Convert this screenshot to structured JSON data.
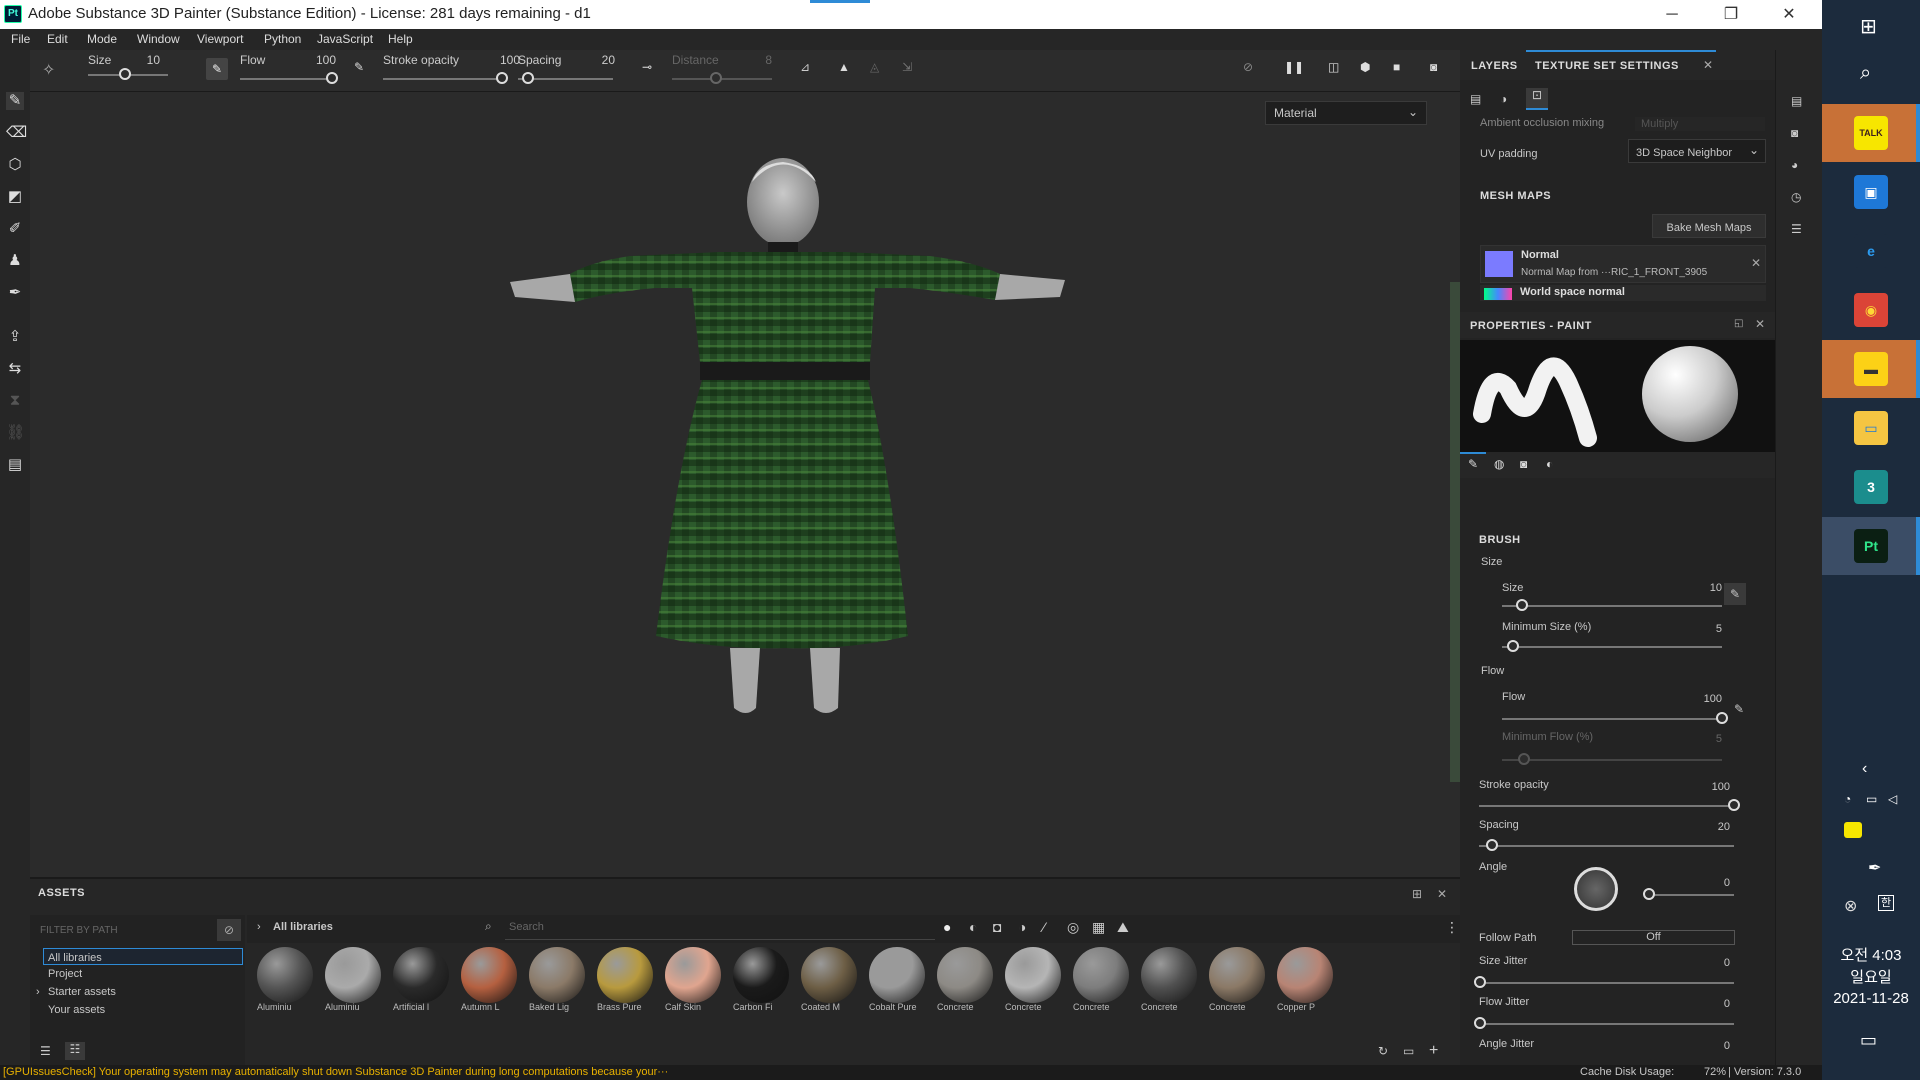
{
  "window": {
    "title": "Adobe Substance 3D Painter (Substance Edition) - License: 281 days remaining - d1",
    "logo": "Pt",
    "minimize_glyph": "─",
    "maximize_glyph": "❐",
    "close_glyph": "✕"
  },
  "menu": [
    "File",
    "Edit",
    "Mode",
    "Window",
    "Viewport",
    "Python",
    "JavaScript",
    "Help"
  ],
  "toolbar": {
    "size_label": "Size",
    "size_value": "10",
    "flow_label": "Flow",
    "flow_value": "100",
    "stroke_label": "Stroke opacity",
    "stroke_value": "100",
    "spacing_label": "Spacing",
    "spacing_value": "20",
    "distance_label": "Distance",
    "distance_value": "8"
  },
  "viewport": {
    "mode_select": "Material"
  },
  "assets": {
    "title": "ASSETS",
    "filter_placeholder": "FILTER BY PATH",
    "tree": [
      "All libraries",
      "Project",
      "Starter assets",
      "Your assets"
    ],
    "breadcrumb": "All libraries",
    "search_placeholder": "Search",
    "materials": [
      {
        "label": "Aluminiu",
        "color": "#555"
      },
      {
        "label": "Aluminiu",
        "color": "#aaa"
      },
      {
        "label": "Artificial l",
        "color": "#2a2a2a"
      },
      {
        "label": "Autumn L",
        "color": "#b56040"
      },
      {
        "label": "Baked Lig",
        "color": "#8b7a68"
      },
      {
        "label": "Brass Pure",
        "color": "#b89a3e"
      },
      {
        "label": "Calf Skin",
        "color": "#e0a58f"
      },
      {
        "label": "Carbon Fi",
        "color": "#1a1a1a"
      },
      {
        "label": "Coated M",
        "color": "#6d5e45"
      },
      {
        "label": "Cobalt Pure",
        "color": "#9a9a9a"
      },
      {
        "label": "Concrete",
        "color": "#8d8a85"
      },
      {
        "label": "Concrete",
        "color": "#b5b5b5"
      },
      {
        "label": "Concrete",
        "color": "#7d7d7d"
      },
      {
        "label": "Concrete",
        "color": "#505050"
      },
      {
        "label": "Concrete",
        "color": "#8b7966"
      },
      {
        "label": "Copper P",
        "color": "#b88474"
      }
    ]
  },
  "texture_set": {
    "tab_layers": "LAYERS",
    "tab_tss": "TEXTURE SET SETTINGS",
    "ao_label": "Ambient occlusion mixing",
    "ao_value": "Multiply",
    "uv_label": "UV padding",
    "uv_value": "3D Space Neighbor",
    "mesh_maps": "MESH MAPS",
    "bake_button": "Bake Mesh Maps",
    "normal_title": "Normal",
    "normal_desc": "Normal Map from ···RIC_1_FRONT_3905",
    "world_normal": "World space normal"
  },
  "properties": {
    "title": "PROPERTIES - PAINT",
    "brush": "BRUSH",
    "size_group": "Size",
    "size_label": "Size",
    "size_value": "10",
    "size_level": 0.09,
    "minsize_label": "Minimum Size (%)",
    "minsize_value": "5",
    "minsize_level": 0.05,
    "flow_group": "Flow",
    "flow_label": "Flow",
    "flow_value": "100",
    "flow_level": 1.0,
    "minflow_label": "Minimum Flow (%)",
    "minflow_value": "5",
    "stroke_label": "Stroke opacity",
    "stroke_value": "100",
    "stroke_level": 1.0,
    "spacing_label": "Spacing",
    "spacing_value": "20",
    "spacing_level": 0.05,
    "angle_label": "Angle",
    "angle_value": "0",
    "follow_label": "Follow Path",
    "follow_value": "Off",
    "sizej_label": "Size Jitter",
    "sizej_value": "0",
    "flowj_label": "Flow Jitter",
    "flowj_value": "0",
    "anglej_label": "Angle Jitter",
    "anglej_value": "0"
  },
  "status": {
    "warning": "[GPUIssuesCheck] Your operating system may automatically shut down Substance 3D Painter during long computations because your···",
    "cache_label": "Cache Disk Usage:",
    "cache_value": "72%",
    "version": "| Version: 7.3.0"
  },
  "taskbar": {
    "time": "오전 4:03",
    "day": "일요일",
    "date": "2021-11-28",
    "ime": "한",
    "apps": [
      {
        "name": "kakaotalk",
        "glyph": "TALK",
        "bg": "#f7e600",
        "fg": "#3c1e1e",
        "tile": "#c87137"
      },
      {
        "name": "remote-desktop",
        "glyph": "▣",
        "bg": "#1e78d7",
        "fg": "#fff",
        "tile": ""
      },
      {
        "name": "internet-explorer",
        "glyph": "e",
        "bg": "#1c2b3d",
        "fg": "#2b9bf0",
        "tile": ""
      },
      {
        "name": "chrome",
        "glyph": "◉",
        "bg": "#db4437",
        "fg": "#fdd835",
        "tile": ""
      },
      {
        "name": "sticky-notes",
        "glyph": "▬",
        "bg": "#fcd116",
        "fg": "#333",
        "tile": "#c87137"
      },
      {
        "name": "file-explorer",
        "glyph": "▭",
        "bg": "#f5c542",
        "fg": "#1e78d7",
        "tile": ""
      },
      {
        "name": "3ds-max",
        "glyph": "3",
        "bg": "#1b8d8d",
        "fg": "#fff",
        "tile": ""
      },
      {
        "name": "substance-painter",
        "glyph": "Pt",
        "bg": "#0b1f13",
        "fg": "#2fe58a",
        "tile": "#3b4d66"
      }
    ],
    "colors": {
      "accent": "#2e8bd6",
      "warning": "#e8b100"
    }
  }
}
